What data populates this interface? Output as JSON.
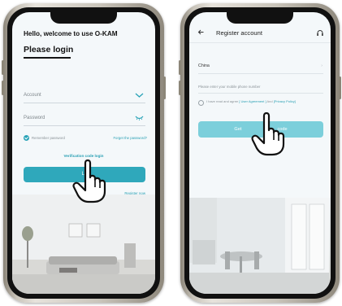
{
  "login_screen": {
    "greeting": "Hello, welcome to use O-KAM",
    "title": "Please login",
    "account_placeholder": "Account",
    "password_placeholder": "Password",
    "remember_label": "Remember password",
    "forgot_label": "Forget the password?",
    "verification_label": "Verification code login",
    "login_button_label": "Lo",
    "register_label": "Register now"
  },
  "register_screen": {
    "back_icon": "back-arrow-icon",
    "title": "Register account",
    "support_icon": "headset-icon",
    "country_value": "China",
    "country_chevron": "›",
    "phone_placeholder": "Please enter your mobile phone number",
    "agree_prefix": "I have read and agree ",
    "user_agreement": "[ User Agreement ]",
    "agree_and": " And ",
    "privacy_policy": "[Privacy Policy]",
    "button_label_left": "Get",
    "button_label_right": "code"
  },
  "colors": {
    "accent": "#2fa8bb",
    "accent_light": "#7ccfdb",
    "link": "#2aa0b4"
  },
  "icons": [
    "chevron-down-icon",
    "check-icon",
    "pointing-hand-icon",
    "back-arrow-icon",
    "headset-icon"
  ]
}
